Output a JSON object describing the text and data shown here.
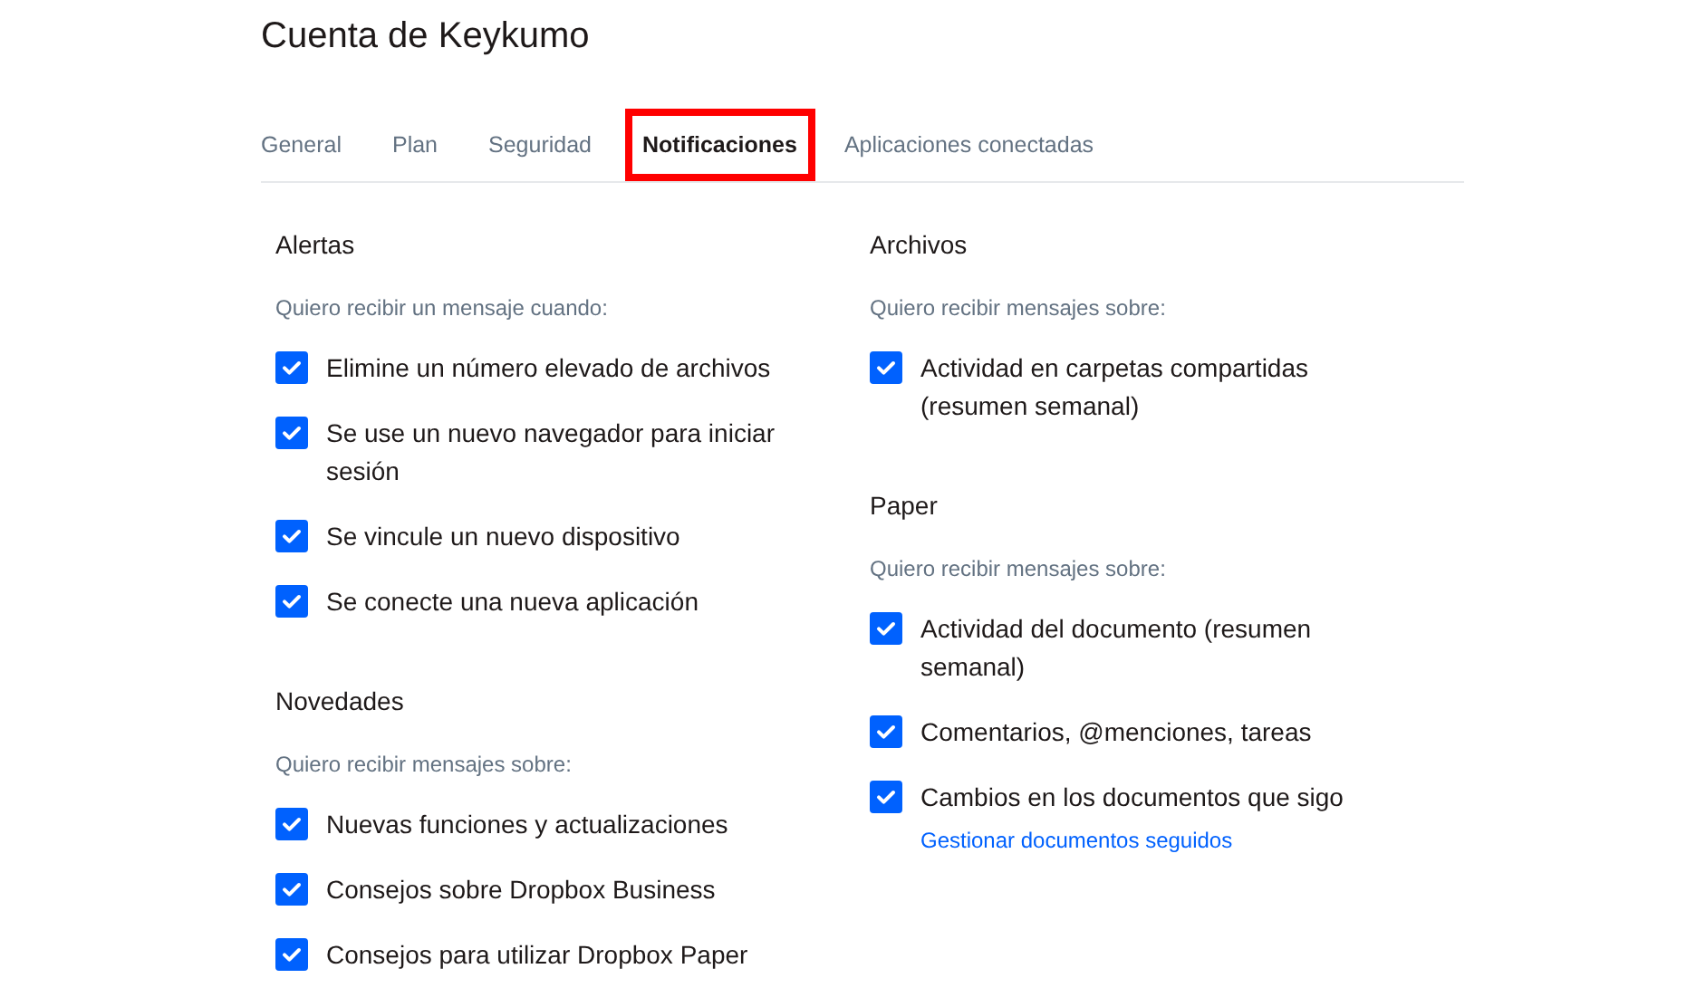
{
  "page": {
    "title": "Cuenta de Keykumo"
  },
  "tabs": [
    {
      "label": "General",
      "selected": false
    },
    {
      "label": "Plan",
      "selected": false
    },
    {
      "label": "Seguridad",
      "selected": false
    },
    {
      "label": "Notificaciones",
      "selected": true
    },
    {
      "label": "Aplicaciones conectadas",
      "selected": false
    }
  ],
  "columns": [
    {
      "sections": [
        {
          "heading": "Alertas",
          "subtitle": "Quiero recibir un mensaje cuando:",
          "options": [
            {
              "label": "Elimine un número elevado de archivos",
              "checked": true
            },
            {
              "label": "Se use un nuevo navegador para iniciar sesión",
              "checked": true
            },
            {
              "label": "Se vincule un nuevo dispositivo",
              "checked": true
            },
            {
              "label": "Se conecte una nueva aplicación",
              "checked": true
            }
          ]
        },
        {
          "heading": "Novedades",
          "subtitle": "Quiero recibir mensajes sobre:",
          "options": [
            {
              "label": "Nuevas funciones y actualizaciones",
              "checked": true
            },
            {
              "label": "Consejos sobre Dropbox Business",
              "checked": true
            },
            {
              "label": "Consejos para utilizar Dropbox Paper",
              "checked": true
            }
          ]
        }
      ]
    },
    {
      "sections": [
        {
          "heading": "Archivos",
          "subtitle": "Quiero recibir mensajes sobre:",
          "options": [
            {
              "label": "Actividad en carpetas compartidas (resumen semanal)",
              "checked": true
            }
          ]
        },
        {
          "heading": "Paper",
          "subtitle": "Quiero recibir mensajes sobre:",
          "options": [
            {
              "label": "Actividad del documento (resumen semanal)",
              "checked": true
            },
            {
              "label": "Comentarios, @menciones, tareas",
              "checked": true
            },
            {
              "label": "Cambios en los documentos que sigo",
              "checked": true,
              "link": "Gestionar documentos seguidos"
            }
          ]
        }
      ]
    }
  ]
}
